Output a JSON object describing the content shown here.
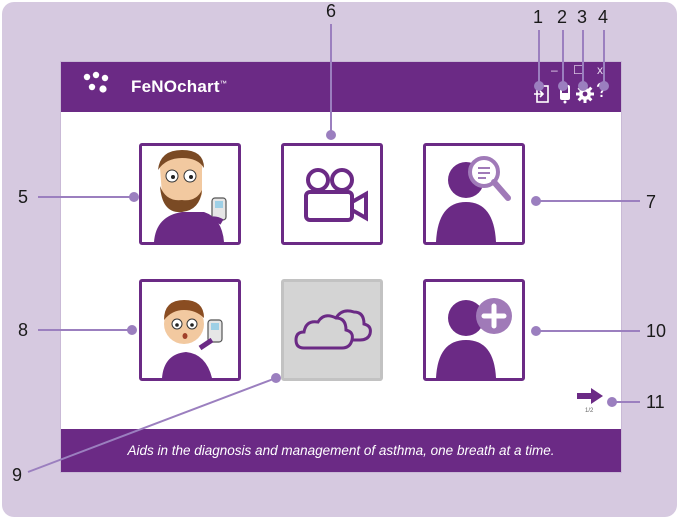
{
  "app": {
    "brand": "FeNOchart",
    "trademark": "™",
    "tagline": "Aids in the diagnosis and management of asthma, one breath at a time."
  },
  "window_controls": {
    "minimize": "–",
    "maximize": "☐",
    "close": "x"
  },
  "toolbar_icons": [
    "logout-icon",
    "device-icon",
    "gear-icon",
    "help-icon"
  ],
  "help_glyph": "?",
  "tiles": [
    {
      "name": "adult-measurement",
      "icon": "bearded-man-with-device-icon"
    },
    {
      "name": "video-tutorial",
      "icon": "video-camera-icon"
    },
    {
      "name": "search-patient",
      "icon": "person-search-icon"
    },
    {
      "name": "child-measurement",
      "icon": "boy-with-device-icon"
    },
    {
      "name": "cloud-sync",
      "icon": "cloud-icon",
      "disabled": true
    },
    {
      "name": "add-patient",
      "icon": "person-add-icon"
    }
  ],
  "pager": {
    "label": "1/2"
  },
  "callouts": {
    "c1": "1",
    "c2": "2",
    "c3": "3",
    "c4": "4",
    "c5": "5",
    "c6": "6",
    "c7": "7",
    "c8": "8",
    "c9": "9",
    "c10": "10",
    "c11": "11"
  },
  "colors": {
    "brand_purple": "#6b2a85",
    "light_purple": "#a07ab8",
    "frame": "#d6c9e0",
    "callout_line": "#9b7fbf",
    "disabled_tile": "#d4d4d4"
  }
}
